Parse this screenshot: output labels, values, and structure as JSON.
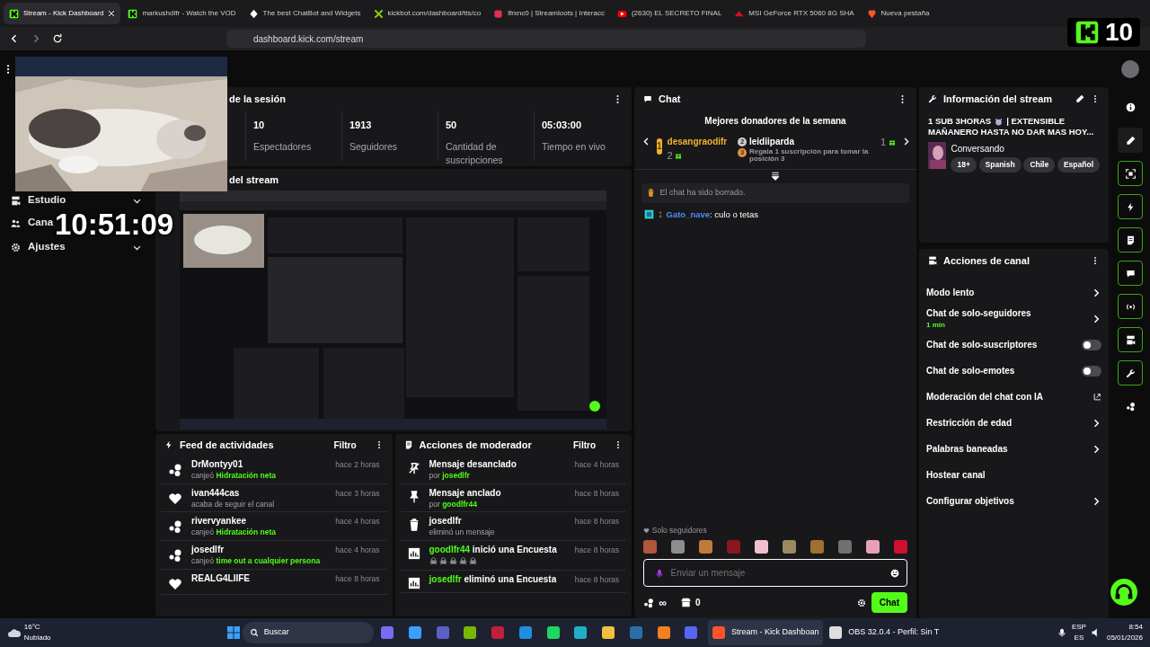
{
  "browser": {
    "tabs": [
      {
        "title": "Stream - Kick Dashboard",
        "selected": true
      },
      {
        "title": "markushdlfr - Watch the VOD",
        "selected": false
      },
      {
        "title": "The best ChatBot and Widgets",
        "selected": false
      },
      {
        "title": "kickbot.com/dashboard/tts/co",
        "selected": false
      },
      {
        "title": "lfrxnc0 | Streamloots | Interacc",
        "selected": false
      },
      {
        "title": "(2630) EL SECRETO FINAL",
        "selected": false
      },
      {
        "title": "MSI GeForce RTX 5060 8G SHA",
        "selected": false
      },
      {
        "title": "Nueva pestaña",
        "selected": false
      }
    ],
    "url": "dashboard.kick.com/stream"
  },
  "overlay": {
    "clock": "10:51:09",
    "viewer_count": "10"
  },
  "sidebar": {
    "items": [
      {
        "label": "Estudio"
      },
      {
        "label": "Cana"
      },
      {
        "label": "Ajustes"
      }
    ]
  },
  "session": {
    "title": "de la sesión",
    "stats": [
      {
        "value": "10",
        "label": "Espectadores"
      },
      {
        "value": "1913",
        "label": "Seguidores"
      },
      {
        "value": "50",
        "label": "Cantidad de suscripciones"
      },
      {
        "value": "05:03:00",
        "label": "Tiempo en vivo"
      }
    ]
  },
  "preview": {
    "title": "del stream"
  },
  "activity_feed": {
    "title": "Feed de actividades",
    "filter": "Filtro",
    "items": [
      {
        "kind": "redeem",
        "user": "DrMontyy01",
        "action": "canjeó",
        "highlight": "Hidratación neta",
        "time": "hace 2 horas"
      },
      {
        "kind": "follow",
        "user": "ivan444cas",
        "action": "acaba de seguir el canal",
        "time": "hace 3 horas"
      },
      {
        "kind": "redeem",
        "user": "rivervyankee",
        "action": "canjeó",
        "highlight": "Hidratación neta",
        "time": "hace 4 horas"
      },
      {
        "kind": "redeem",
        "user": "josedlfr",
        "action": "canjeó",
        "highlight": "time out a cualquier persona",
        "time": "hace 4 horas"
      },
      {
        "kind": "follow",
        "user": "REALG4LIIFE",
        "time": "hace 8 horas"
      }
    ]
  },
  "mod_actions": {
    "title": "Acciones de moderador",
    "filter": "Filtro",
    "items": [
      {
        "kind": "unpin",
        "title": "Mensaje desanclado",
        "by_label": "por",
        "by": "josedlfr",
        "time": "hace 4 horas"
      },
      {
        "kind": "pin",
        "title": "Mensaje anclado",
        "by_label": "por",
        "by": "goodlfr44",
        "time": "hace 8 horas"
      },
      {
        "kind": "delete",
        "title": "josedlfr",
        "detail": "eliminó un mensaje",
        "time": "hace 8 horas"
      },
      {
        "kind": "poll",
        "user": "goodlfr44",
        "action": "inició una Encuesta",
        "time": "hace 8 horas",
        "detail": "☠☠☠☠☠"
      },
      {
        "kind": "poll",
        "user": "josedlfr",
        "action": "eliminó una Encuesta",
        "time": "hace 8 horas"
      }
    ]
  },
  "chat": {
    "title": "Chat",
    "leaderboard": {
      "title": "Mejores donadores de la semana",
      "entries": [
        {
          "rank": "1",
          "name": "desangraodifr",
          "count": "2"
        },
        {
          "rank": "2",
          "name": "leidiiparda",
          "hint_rank": "3",
          "hint": "Regala 1 suscripción para tomar la posición 3",
          "count": "1"
        }
      ]
    },
    "messages": [
      {
        "kind": "system",
        "text": "El chat ha sido borrado."
      },
      {
        "kind": "user",
        "user": "Gato_nave",
        "separator": ":",
        "text": "culo o tetas"
      }
    ],
    "mode": "Solo seguidores",
    "emotes": [
      {
        "color": "#b0563a"
      },
      {
        "color": "#8d8d8d"
      },
      {
        "color": "#c07a3a"
      },
      {
        "color": "#8a1620"
      },
      {
        "color": "#f0c0d0"
      },
      {
        "color": "#9a8a60"
      },
      {
        "color": "#a07030"
      },
      {
        "color": "#707070"
      },
      {
        "color": "#e8a0b8"
      },
      {
        "color": "#d01030"
      }
    ],
    "input": {
      "placeholder": "Enviar un mensaje"
    },
    "points": "∞",
    "drops": "0",
    "send": "Chat"
  },
  "stream_info": {
    "title": "Información del stream",
    "stream_title_start": "1 SUB 3HORAS",
    "stream_title_middle": "| EXTENSIBLE",
    "stream_title_end": "MAÑANERO HASTA NO DAR MAS HOY...",
    "category": "Conversando",
    "tags": [
      "18+",
      "Spanish",
      "Chile",
      "Español"
    ]
  },
  "channel_actions": {
    "title": "Acciones de canal",
    "items": [
      {
        "kind": "arrow",
        "label": "Modo lento"
      },
      {
        "kind": "arrow",
        "label": "Chat de solo-seguidores",
        "sub": "1 min"
      },
      {
        "kind": "toggle",
        "label": "Chat de solo-suscriptores",
        "on": false
      },
      {
        "kind": "toggle",
        "label": "Chat de solo-emotes",
        "on": false
      },
      {
        "kind": "external",
        "label": "Moderación del chat con IA"
      },
      {
        "kind": "arrow",
        "label": "Restricción de edad"
      },
      {
        "kind": "arrow",
        "label": "Palabras baneadas"
      },
      {
        "kind": "plain",
        "label": "Hostear canal"
      },
      {
        "kind": "arrow",
        "label": "Configurar objetivos"
      }
    ]
  },
  "taskbar": {
    "temperature": "16°C",
    "weather": "Nublado",
    "search": "Buscar",
    "apps": [
      {
        "kind": "copilot"
      },
      {
        "kind": "store"
      },
      {
        "kind": "teams"
      },
      {
        "kind": "nvidia"
      },
      {
        "kind": "game"
      },
      {
        "kind": "mail"
      },
      {
        "kind": "spotify"
      },
      {
        "kind": "edge"
      },
      {
        "kind": "folder"
      },
      {
        "kind": "steam"
      },
      {
        "kind": "vlc"
      },
      {
        "kind": "discord"
      },
      {
        "kind": "brave",
        "label": "Stream - Kick Dashboan",
        "selected": true
      },
      {
        "kind": "obs",
        "label": "OBS 32.0.4 - Perfil: Sin T",
        "selected": false
      }
    ],
    "lang": "ESP",
    "layout": "ES",
    "time": "8:54",
    "date": "05/01/2026"
  }
}
